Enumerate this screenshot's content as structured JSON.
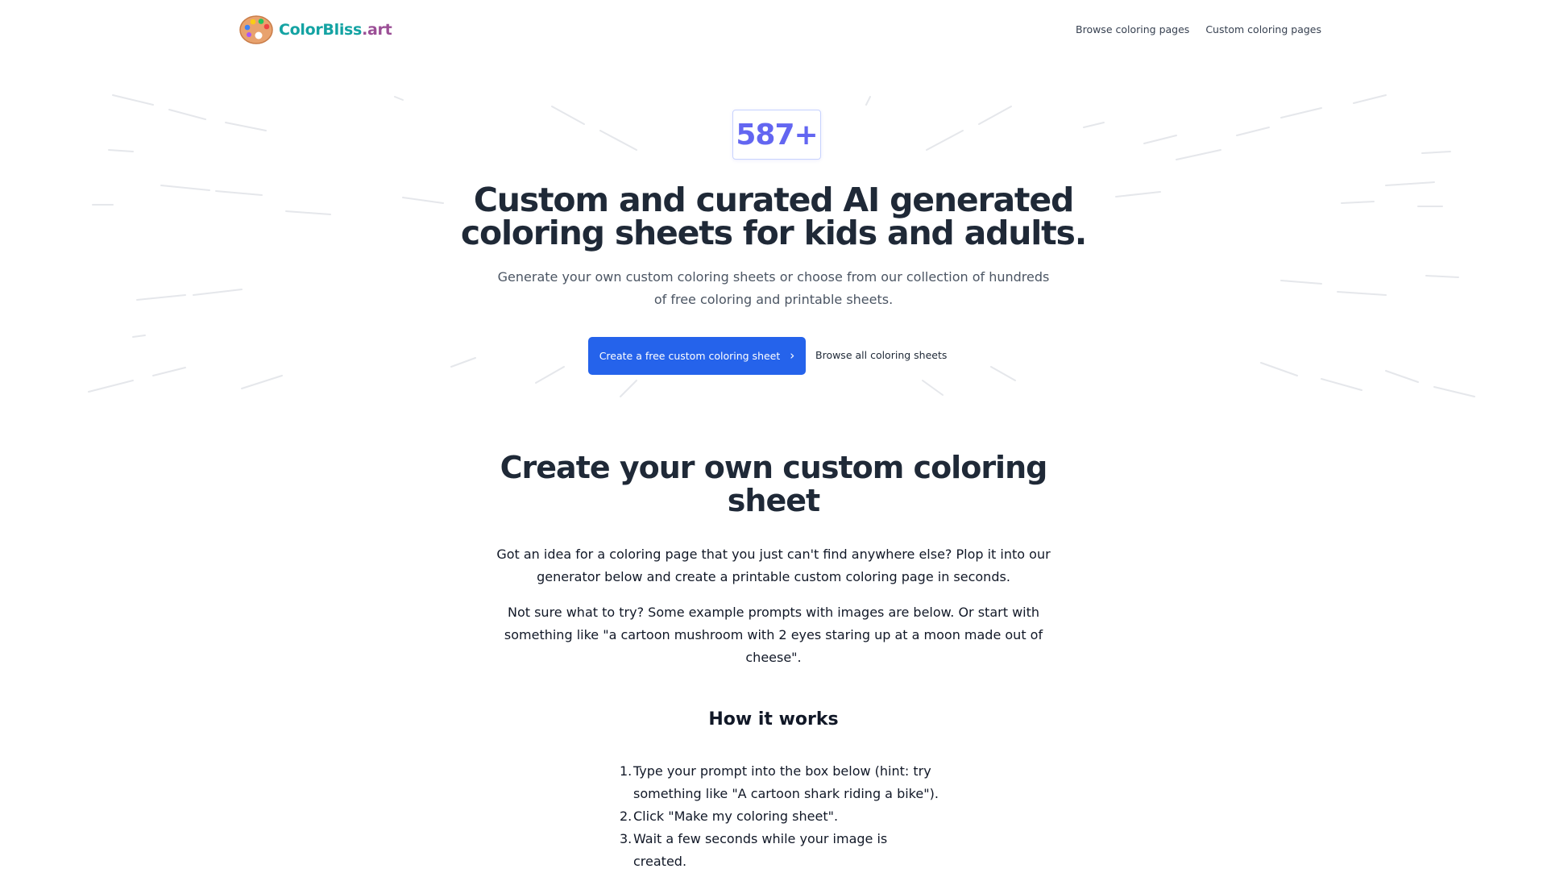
{
  "header": {
    "logo": {
      "brand": "ColorBliss",
      "tld": ".art"
    },
    "nav": [
      {
        "label": "Browse coloring pages"
      },
      {
        "label": "Custom coloring pages"
      }
    ]
  },
  "hero": {
    "count": "587+",
    "title": "Custom and curated AI generated coloring sheets for kids and adults.",
    "subtitle": "Generate your own custom coloring sheets or choose from our collection of hundreds of free coloring and printable sheets.",
    "primary_cta": "Create a free custom coloring sheet",
    "secondary_cta": "Browse all coloring sheets"
  },
  "create_section": {
    "title": "Create your own custom coloring sheet",
    "paragraph1": "Got an idea for a coloring page that you just can't find anywhere else? Plop it into our generator below and create a printable custom coloring page in seconds.",
    "paragraph2": "Not sure what to try? Some example prompts with images are below. Or start with something like \"a cartoon mushroom with 2 eyes staring up at a moon made out of cheese\".",
    "how_title": "How it works",
    "steps": [
      {
        "num": "1.",
        "text": "Type your prompt into the box below (hint: try something like \"A cartoon shark riding a bike\")."
      },
      {
        "num": "2.",
        "text": "Click \"Make my coloring sheet\"."
      },
      {
        "num": "3.",
        "text": "Wait a few seconds while your image is created."
      }
    ]
  },
  "colors": {
    "primary": "#2563eb",
    "accent_purple": "#6366f1",
    "brand_teal": "#14a3a3",
    "brand_purple": "#9b4f96",
    "text_dark": "#1f2937",
    "text_muted": "#4b5563"
  },
  "icons": {
    "logo": "paint-palette-icon",
    "cta": "chevron-right-icon"
  }
}
